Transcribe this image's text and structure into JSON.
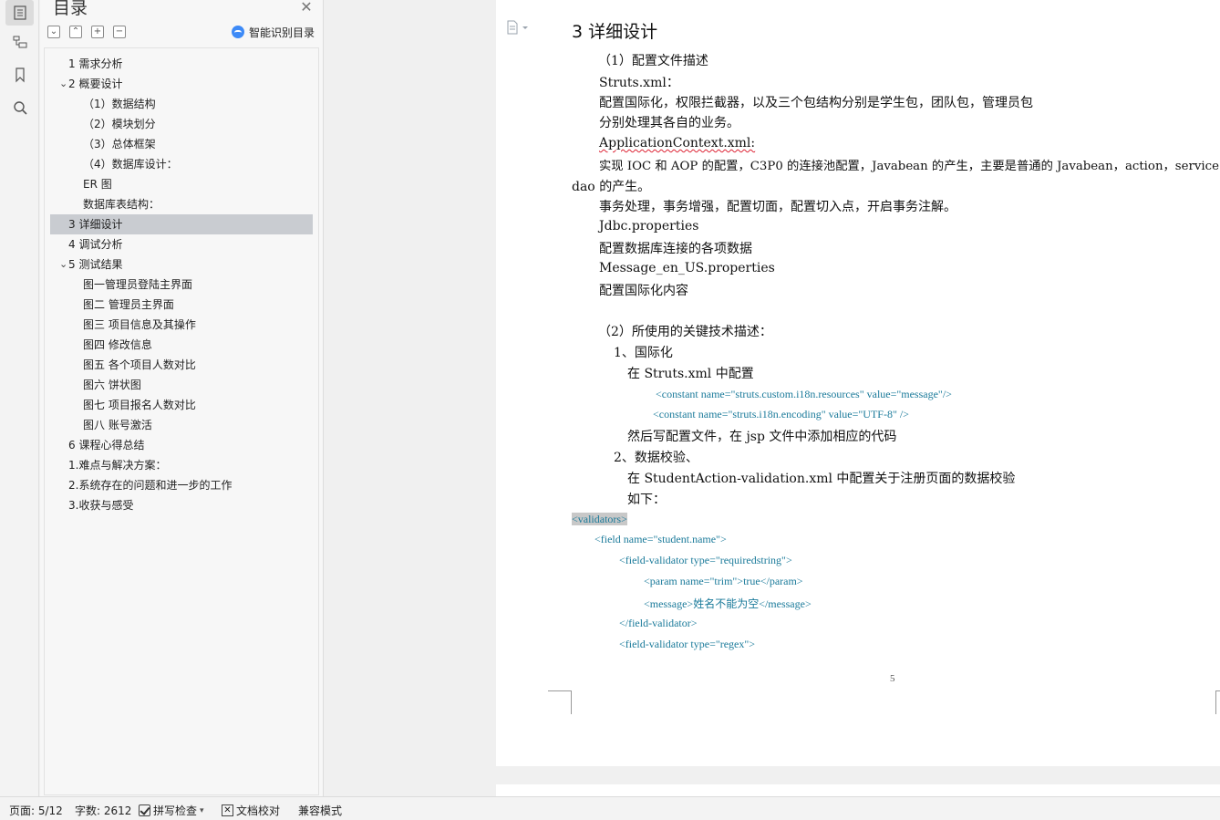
{
  "toc": {
    "title": "目录",
    "smart_label": "智能识别目录",
    "items": [
      {
        "label": "1  需求分析"
      },
      {
        "label": "2  概要设计"
      },
      {
        "label": "（1）数据结构"
      },
      {
        "label": "（2）模块划分"
      },
      {
        "label": "（3）总体框架"
      },
      {
        "label": "（4）数据库设计："
      },
      {
        "label": "ER 图"
      },
      {
        "label": "数据库表结构："
      },
      {
        "label": "3  详细设计"
      },
      {
        "label": "4  调试分析"
      },
      {
        "label": "5    测试结果"
      },
      {
        "label": "图一管理员登陆主界面"
      },
      {
        "label": "图二  管理员主界面"
      },
      {
        "label": "图三  项目信息及其操作"
      },
      {
        "label": "图四  修改信息"
      },
      {
        "label": "图五  各个项目人数对比"
      },
      {
        "label": "图六  饼状图"
      },
      {
        "label": "图七  项目报名人数对比"
      },
      {
        "label": "图八  账号激活"
      },
      {
        "label": "6  课程心得总结"
      },
      {
        "label": "1.难点与解决方案："
      },
      {
        "label": "2.系统存在的问题和进一步的工作"
      },
      {
        "label": "3.收获与感受"
      }
    ]
  },
  "doc": {
    "heading": "3  详细设计",
    "p1": "（1）配置文件描述",
    "p2": "Struts.xml：",
    "p3": "配置国际化，权限拦截器，以及三个包结构分别是学生包，团队包，管理员包",
    "p4": "分别处理其各自的业务。",
    "p5": "ApplicationContext.xml:",
    "p6": "实现 IOC 和 AOP 的配置，C3P0 的连接池配置，Javabean 的产生，主要是普通的 Javabean，action，service，",
    "p7": "dao 的产生。",
    "p8": "事务处理，事务增强，配置切面，配置切入点，开启事务注解。",
    "p9": "Jdbc.properties",
    "p10": "配置数据库连接的各项数据",
    "p11": "Message_en_US.properties",
    "p12": "配置国际化内容",
    "p13": "（2）所使用的关键技术描述：",
    "p14": "1、国际化",
    "p15": "在 Struts.xml 中配置",
    "c1": "<constant name=\"struts.custom.i18n.resources\" value=\"message\"/>",
    "c2": "<constant name=\"struts.i18n.encoding\" value=\"UTF-8\" />",
    "p16": "然后写配置文件，在 jsp 文件中添加相应的代码",
    "p17": "2、数据校验、",
    "p18": "在 StudentAction-validation.xml 中配置关于注册页面的数据校验",
    "p19": "如下：",
    "c3": "<validators>",
    "c4": "<field name=\"student.name\">",
    "c5": "<field-validator type=\"requiredstring\">",
    "c6": "<param name=\"trim\">true</param>",
    "c7": "<message>姓名不能为空</message>",
    "c8": "</field-validator>",
    "c9": "<field-validator type=\"regex\">",
    "page_number": "5"
  },
  "status": {
    "page": "页面: 5/12",
    "words": "字数: 2612",
    "spell": "拼写检查",
    "proof": "文档校对",
    "compat": "兼容模式"
  }
}
